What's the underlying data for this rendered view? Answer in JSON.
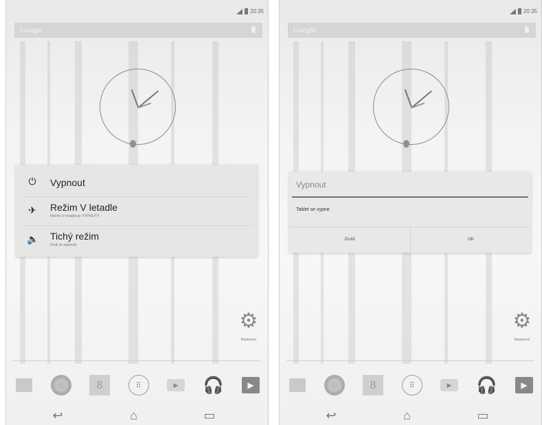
{
  "status": {
    "time_left": "20:35",
    "time_right": "20:35"
  },
  "search": {
    "label": "Google"
  },
  "power_menu": {
    "items": [
      {
        "label": "Vypnout"
      },
      {
        "label": "Režim V letadle",
        "sublabel": "Režim V letadle je VYPNUTÝ"
      },
      {
        "label": "Tichý režim",
        "sublabel": "Zvuk je zapnutý"
      }
    ]
  },
  "dialog": {
    "title": "Vypnout",
    "message": "Tablet se vypne.",
    "cancel_label": "Zrušit",
    "ok_label": "OK"
  },
  "widget": {
    "settings_label": "Nastavení"
  },
  "dock": {
    "apps": [
      "folder-icon",
      "chrome-icon",
      "google-plus-icon",
      "app-drawer-icon",
      "youtube-icon",
      "play-music-icon",
      "play-store-icon"
    ]
  },
  "colors": {
    "accent": "#6f6f6f",
    "menu_bg": "#e6e6e6",
    "wallpaper": "#f0f0f0"
  }
}
